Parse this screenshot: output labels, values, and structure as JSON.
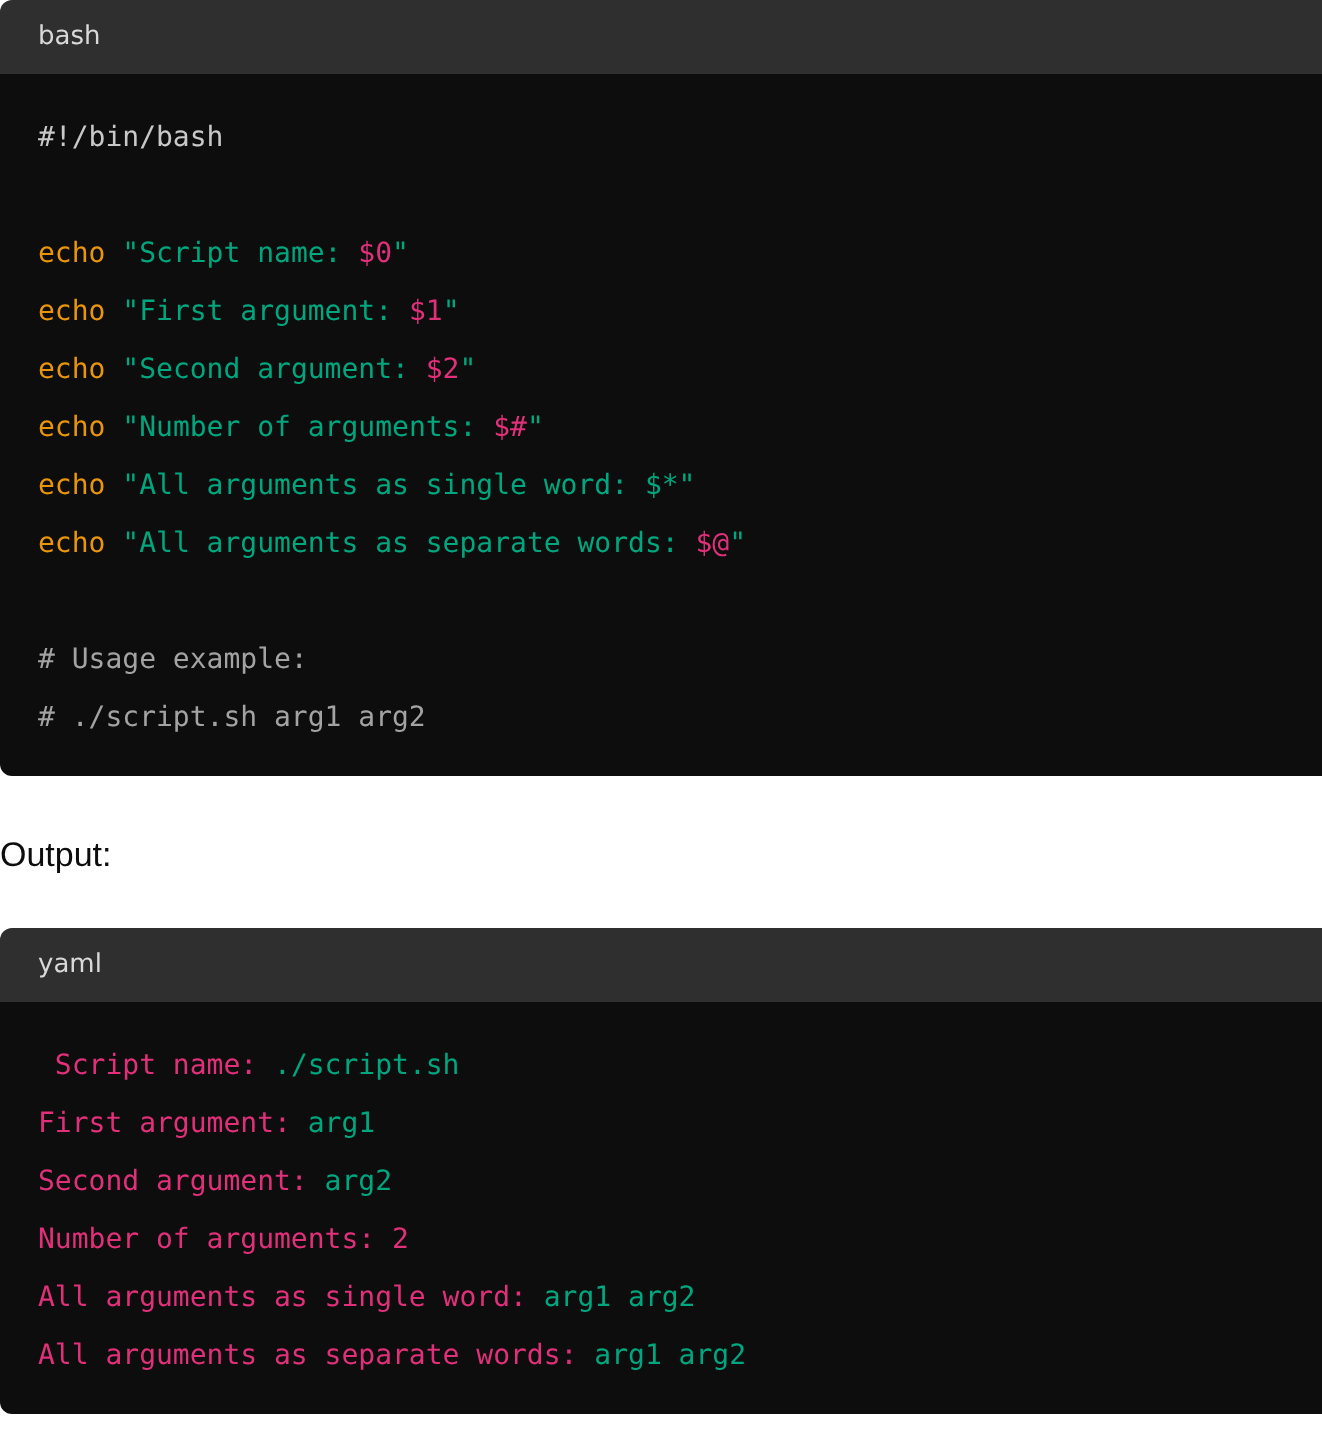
{
  "blocks": [
    {
      "language": "bash",
      "lines": [
        {
          "kind": "code",
          "tokens": [
            {
              "kind": "plain",
              "text": "#!/bin/bash"
            }
          ]
        },
        {
          "kind": "blank"
        },
        {
          "kind": "code",
          "tokens": [
            {
              "kind": "keyword",
              "text": "echo "
            },
            {
              "kind": "string",
              "text": "\"Script name: "
            },
            {
              "kind": "variable",
              "text": "$0"
            },
            {
              "kind": "string",
              "text": "\""
            }
          ]
        },
        {
          "kind": "code",
          "tokens": [
            {
              "kind": "keyword",
              "text": "echo "
            },
            {
              "kind": "string",
              "text": "\"First argument: "
            },
            {
              "kind": "variable",
              "text": "$1"
            },
            {
              "kind": "string",
              "text": "\""
            }
          ]
        },
        {
          "kind": "code",
          "tokens": [
            {
              "kind": "keyword",
              "text": "echo "
            },
            {
              "kind": "string",
              "text": "\"Second argument: "
            },
            {
              "kind": "variable",
              "text": "$2"
            },
            {
              "kind": "string",
              "text": "\""
            }
          ]
        },
        {
          "kind": "code",
          "tokens": [
            {
              "kind": "keyword",
              "text": "echo "
            },
            {
              "kind": "string",
              "text": "\"Number of arguments: "
            },
            {
              "kind": "variable",
              "text": "$#"
            },
            {
              "kind": "string",
              "text": "\""
            }
          ]
        },
        {
          "kind": "code",
          "tokens": [
            {
              "kind": "keyword",
              "text": "echo "
            },
            {
              "kind": "string",
              "text": "\"All arguments as single word: $*\""
            }
          ]
        },
        {
          "kind": "code",
          "tokens": [
            {
              "kind": "keyword",
              "text": "echo "
            },
            {
              "kind": "string",
              "text": "\"All arguments as separate words: "
            },
            {
              "kind": "variable",
              "text": "$@"
            },
            {
              "kind": "string",
              "text": "\""
            }
          ]
        },
        {
          "kind": "blank"
        },
        {
          "kind": "code",
          "tokens": [
            {
              "kind": "comment",
              "text": "# Usage example:"
            }
          ]
        },
        {
          "kind": "code",
          "tokens": [
            {
              "kind": "comment",
              "text": "# ./script.sh arg1 arg2"
            }
          ]
        }
      ]
    },
    {
      "label": "Output:"
    },
    {
      "language": "yaml",
      "lines": [
        {
          "kind": "code",
          "tokens": [
            {
              "kind": "key",
              "text": " Script name: "
            },
            {
              "kind": "value",
              "text": "./script.sh"
            }
          ]
        },
        {
          "kind": "code",
          "tokens": [
            {
              "kind": "key",
              "text": "First argument: "
            },
            {
              "kind": "value",
              "text": "arg1"
            }
          ]
        },
        {
          "kind": "code",
          "tokens": [
            {
              "kind": "key",
              "text": "Second argument: "
            },
            {
              "kind": "value",
              "text": "arg2"
            }
          ]
        },
        {
          "kind": "code",
          "tokens": [
            {
              "kind": "key",
              "text": "Number of arguments: 2"
            }
          ]
        },
        {
          "kind": "code",
          "tokens": [
            {
              "kind": "key",
              "text": "All arguments as single word: "
            },
            {
              "kind": "value",
              "text": "arg1 arg2"
            }
          ]
        },
        {
          "kind": "code",
          "tokens": [
            {
              "kind": "key",
              "text": "All arguments as separate words: "
            },
            {
              "kind": "value",
              "text": "arg1 arg2"
            }
          ]
        }
      ]
    }
  ]
}
